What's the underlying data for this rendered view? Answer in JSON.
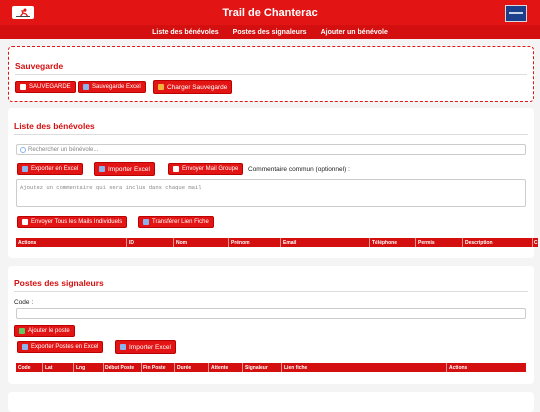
{
  "header": {
    "title": "Trail de Chanterac",
    "logo_left": "runner-logo-icon",
    "logo_right": "partner-logo-icon"
  },
  "nav": {
    "items": [
      "Liste des bénévoles",
      "Postes des signaleurs",
      "Ajouter un bénévole"
    ]
  },
  "sauvegarde": {
    "title": "Sauvegarde",
    "buttons": [
      "SAUVEGARDE",
      "Sauvegarde Excel",
      "Charger Sauvegarde"
    ]
  },
  "benevoles": {
    "title": "Liste des bénévoles",
    "search_placeholder": "Rechercher un bénévole...",
    "export_label": "Exporter en Excel",
    "import_label": "Importer Excel",
    "mail_group_label": "Envoyer Mail Groupe",
    "comment_label": "Commentaire commun (optionnel) :",
    "comment_placeholder": "Ajoutez un commentaire qui sera inclus dans chaque mail",
    "send_all_label": "Envoyer Tous les Mails Individuels",
    "transfer_label": "Transférer Lien Fiche",
    "columns": [
      "Actions",
      "ID",
      "Nom",
      "Prénom",
      "Email",
      "Téléphone",
      "Permis",
      "Description",
      "C"
    ]
  },
  "postes": {
    "title": "Postes des signaleurs",
    "code_label": "Code :",
    "add_label": "Ajouter le poste",
    "export_label": "Exporter Postes en Excel",
    "import_label": "Importer Excel",
    "columns": [
      "Code",
      "Lat",
      "Lng",
      "Début Poste",
      "Fin Poste",
      "Durée",
      "Attente",
      "Signaleur",
      "Lien fiche",
      "Actions"
    ]
  },
  "colors": {
    "accent": "#e31414",
    "nav": "#d40f0f"
  }
}
